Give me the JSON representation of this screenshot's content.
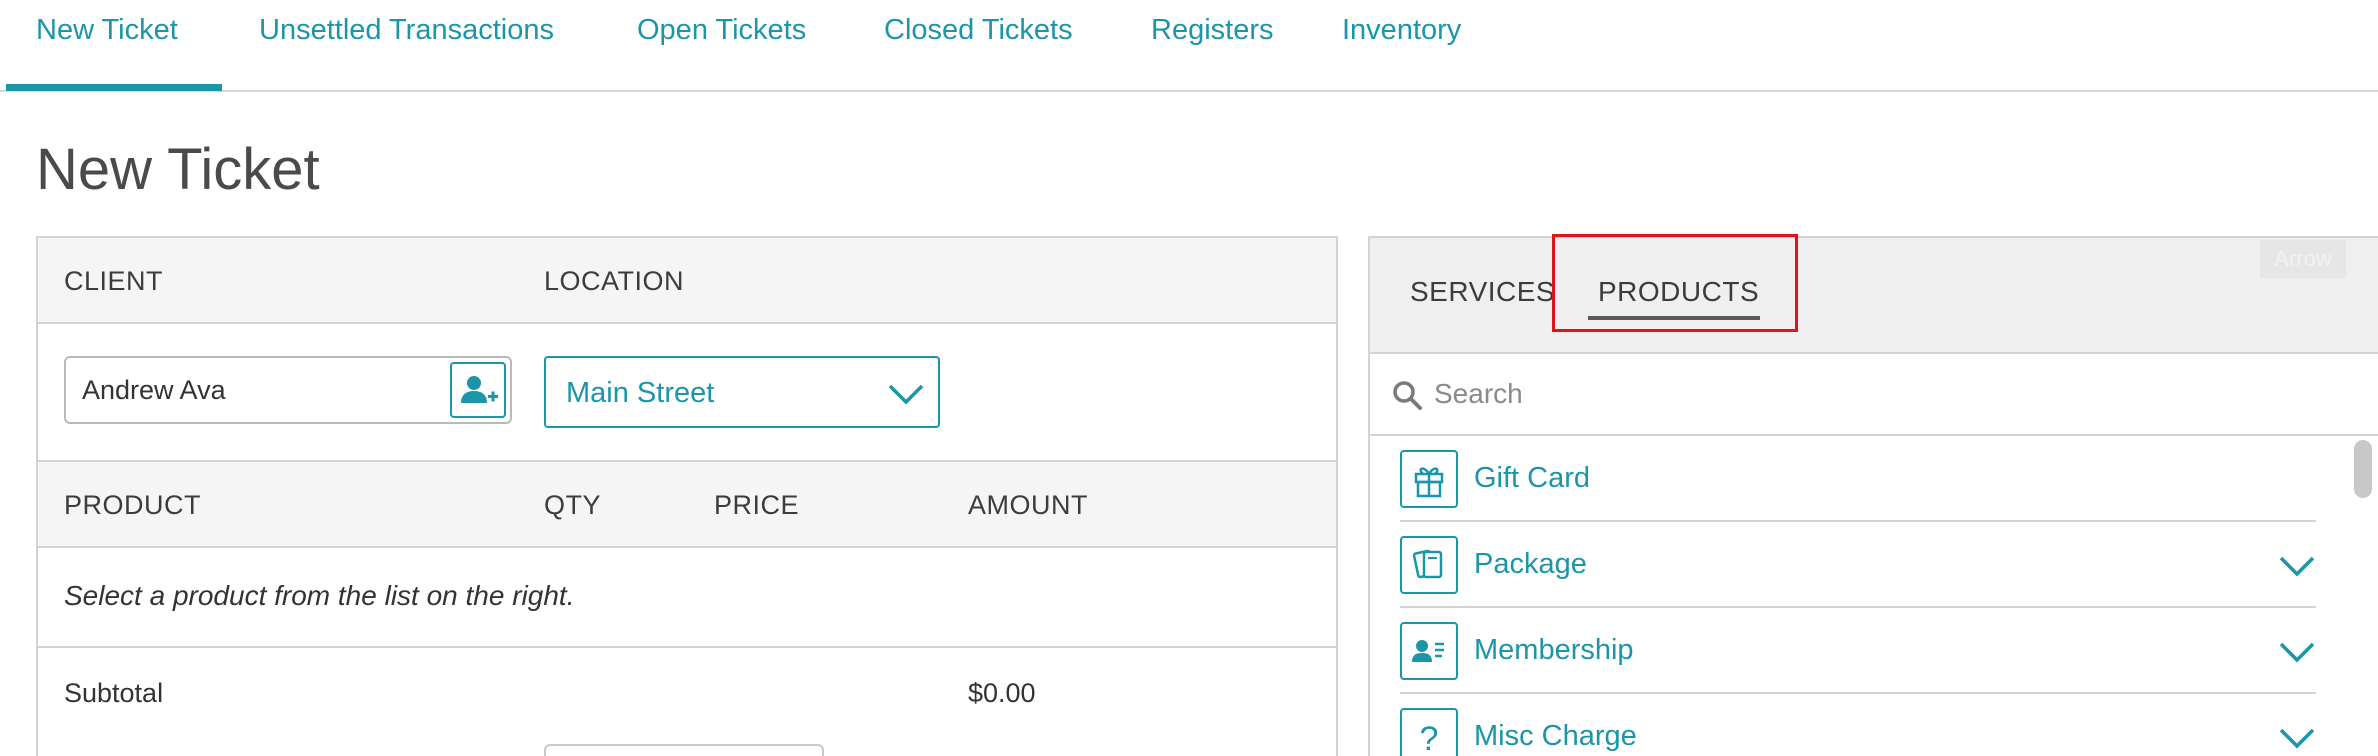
{
  "nav": {
    "tabs": [
      {
        "label": "New Ticket"
      },
      {
        "label": "Unsettled Transactions"
      },
      {
        "label": "Open Tickets"
      },
      {
        "label": "Closed Tickets"
      },
      {
        "label": "Registers"
      },
      {
        "label": "Inventory"
      }
    ],
    "active_index": 0
  },
  "page": {
    "title": "New Ticket"
  },
  "ticket": {
    "headers": {
      "client": "CLIENT",
      "location": "LOCATION"
    },
    "client": {
      "value": "Andrew Ava"
    },
    "location": {
      "value": "Main Street"
    },
    "columns": {
      "product": "PRODUCT",
      "qty": "QTY",
      "price": "PRICE",
      "amount": "AMOUNT"
    },
    "empty_message": "Select a product from the list on the right.",
    "subtotal": {
      "label": "Subtotal",
      "value": "$0.00"
    }
  },
  "catalog": {
    "tabs": [
      {
        "label": "SERVICES"
      },
      {
        "label": "PRODUCTS"
      }
    ],
    "active_tab": "PRODUCTS",
    "arrow_label": "Arrow",
    "search": {
      "placeholder": "Search"
    },
    "items": [
      {
        "label": "Gift Card",
        "icon": "gift-icon",
        "expandable": false
      },
      {
        "label": "Package",
        "icon": "package-icon",
        "expandable": true
      },
      {
        "label": "Membership",
        "icon": "membership-icon",
        "expandable": true
      },
      {
        "label": "Misc Charge",
        "icon": "question-icon",
        "expandable": true
      }
    ]
  },
  "colors": {
    "accent": "#1a96a8",
    "highlight": "#e0121b"
  }
}
